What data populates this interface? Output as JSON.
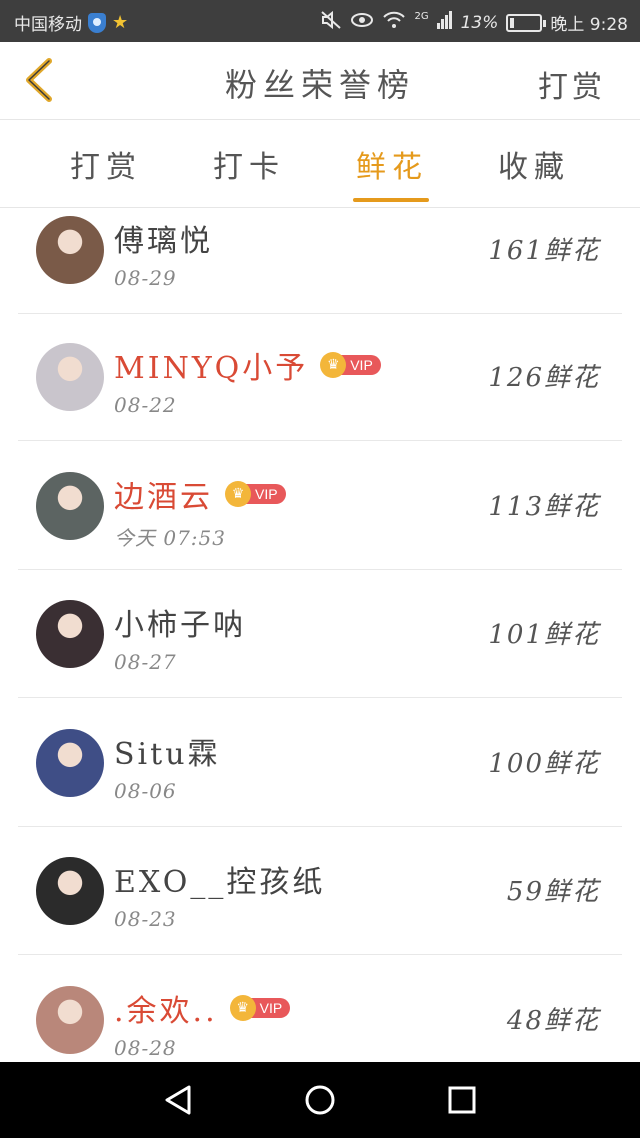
{
  "status_bar": {
    "carrier": "中国移动",
    "battery": "13%",
    "time": "晚上 9:28",
    "signal": "2G",
    "battery_level": 0.13
  },
  "header": {
    "title": "粉丝荣誉榜",
    "right_action": "打赏"
  },
  "tabs": [
    {
      "label": "打赏",
      "active": false
    },
    {
      "label": "打卡",
      "active": false
    },
    {
      "label": "鲜花",
      "active": true
    },
    {
      "label": "收藏",
      "active": false
    }
  ],
  "vip_label": "VIP",
  "list": [
    {
      "name": "傅璃悦",
      "date": "08-29",
      "count": "161鲜花",
      "vip": false,
      "avatar_color": "#7a5a48"
    },
    {
      "name": "MINYQ小予",
      "date": "08-22",
      "count": "126鲜花",
      "vip": true,
      "avatar_color": "#c9c5cc"
    },
    {
      "name": "边酒云",
      "date": "今天  07:53",
      "count": "113鲜花",
      "vip": true,
      "avatar_color": "#5c6462"
    },
    {
      "name": "小柿子呐",
      "date": "08-27",
      "count": "101鲜花",
      "vip": false,
      "avatar_color": "#3a2f33"
    },
    {
      "name": "Situ霖",
      "date": "08-06",
      "count": "100鲜花",
      "vip": false,
      "avatar_color": "#3f4e86"
    },
    {
      "name": "EXO__控孩纸",
      "date": "08-23",
      "count": "59鲜花",
      "vip": false,
      "avatar_color": "#2b2b2b"
    },
    {
      "name": ".余欢..",
      "date": "08-28",
      "count": "48鲜花",
      "vip": true,
      "avatar_color": "#b9877a"
    }
  ],
  "colors": {
    "accent": "#e59a1c",
    "vip_name": "#d94a35",
    "status_bar": "#3e3e3e",
    "nav_bar": "#000000"
  }
}
